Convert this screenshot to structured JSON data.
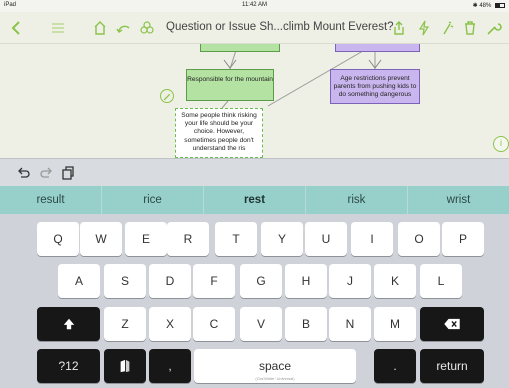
{
  "status_bar": {
    "device": "iPad",
    "time": "11:42 AM",
    "battery": "48%"
  },
  "toolbar": {
    "title": "Question or Issue  Sh...climb Mount Everest?",
    "icons": [
      "back-chevron-icon",
      "list-icon",
      "home-icon",
      "undo-arc-icon",
      "biohazard-icon",
      "share-icon",
      "lightning-icon",
      "wand-icon",
      "trash-icon",
      "wrench-icon"
    ]
  },
  "canvas": {
    "green_node": "Responsible for the mountain",
    "purple_node": "Age restrictions prevent parents from pushing kids to do something dangerous",
    "edit_node": "Some people think risking your life should be your choice. However, sometimes people don't understand the ris"
  },
  "keyboard": {
    "suggestions": [
      "result",
      "rice",
      "rest",
      "risk",
      "wrist"
    ],
    "highlighted_suggestion": "rest",
    "row1": [
      "Q",
      "W",
      "E",
      "R",
      "T",
      "Y",
      "U",
      "I",
      "O",
      "P"
    ],
    "row2": [
      "A",
      "S",
      "D",
      "F",
      "G",
      "H",
      "J",
      "K",
      "L"
    ],
    "row3": [
      "Z",
      "X",
      "C",
      "V",
      "B",
      "N",
      "M"
    ],
    "numbers_key": "?12",
    "comma_key": ",",
    "space_key": "space",
    "space_sublabel": "(Gra'Writer' Universal)",
    "period_key": ".",
    "return_key": "return"
  },
  "colors": {
    "accent_green": "#8bc34a",
    "suggestion_bar": "#97cfca",
    "green_node": "#b4e2a3",
    "purple_node": "#c9b6ee"
  }
}
